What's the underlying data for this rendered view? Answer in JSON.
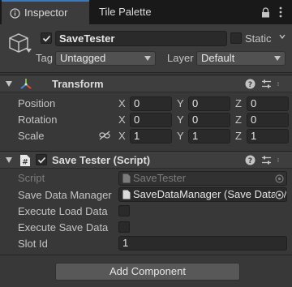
{
  "tabs": [
    {
      "label": "Inspector",
      "icon": "info-icon"
    },
    {
      "label": "Tile Palette"
    }
  ],
  "gameobject": {
    "name": "SaveTester",
    "active": true,
    "static_label": "Static",
    "tag_label": "Tag",
    "tag_value": "Untagged",
    "layer_label": "Layer",
    "layer_value": "Default"
  },
  "transform": {
    "title": "Transform",
    "rows": [
      {
        "label": "Position",
        "x": "0",
        "y": "0",
        "z": "0"
      },
      {
        "label": "Rotation",
        "x": "0",
        "y": "0",
        "z": "0"
      },
      {
        "label": "Scale",
        "x": "1",
        "y": "1",
        "z": "1"
      }
    ],
    "axes": [
      "X",
      "Y",
      "Z"
    ]
  },
  "script_component": {
    "title": "Save Tester (Script)",
    "enabled": true,
    "script_label": "Script",
    "script_value": "SaveTester",
    "save_data_manager_label": "Save Data Manager",
    "save_data_manager_value": "SaveDataManager (Save Data M",
    "execute_load_label": "Execute Load Data",
    "execute_save_label": "Execute Save Data",
    "slot_id_label": "Slot Id",
    "slot_id_value": "1"
  },
  "add_component_label": "Add Component",
  "colors": {
    "accent": "#3a79bb",
    "background": "#383838",
    "field": "#2a2a2a"
  }
}
